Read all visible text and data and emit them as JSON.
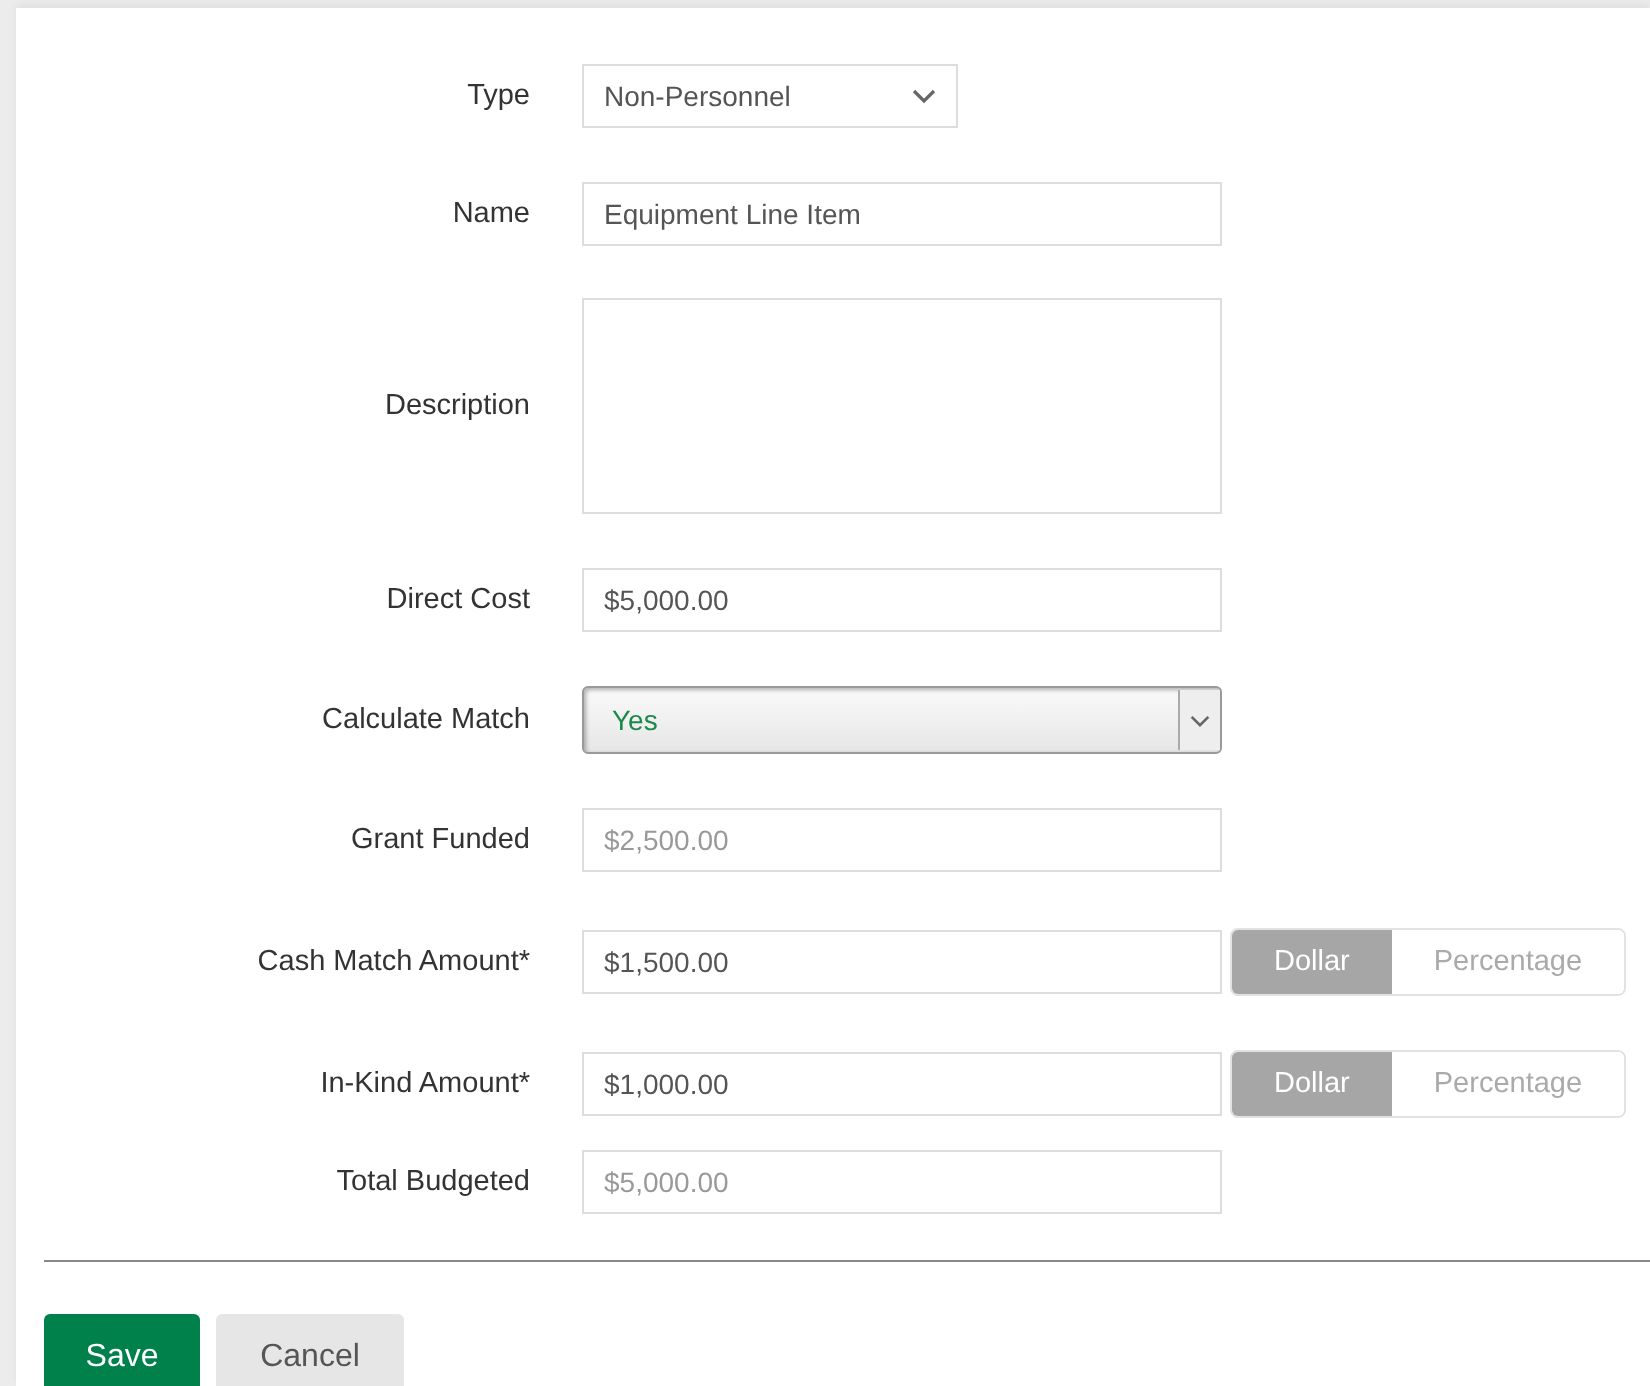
{
  "fields": [
    {
      "kind": "select",
      "label": "Type",
      "value": "Non-Personnel"
    },
    {
      "kind": "text",
      "label": "Name",
      "value": "Equipment Line Item"
    },
    {
      "kind": "textarea",
      "label": "Description"
    },
    {
      "kind": "text",
      "label": "Direct Cost",
      "value": "$5,000.00"
    },
    {
      "kind": "native-select",
      "label": "Calculate Match",
      "value": "Yes"
    },
    {
      "kind": "readonly",
      "label": "Grant Funded",
      "value": "$2,500.00"
    },
    {
      "kind": "amount",
      "label": "Cash Match Amount*",
      "value": "$1,500.00",
      "options": [
        {
          "label": "Dollar",
          "selected": true
        },
        {
          "label": "Percentage",
          "selected": false
        }
      ]
    },
    {
      "kind": "amount",
      "label": "In-Kind Amount*",
      "value": "$1,000.00",
      "options": [
        {
          "label": "Dollar",
          "selected": true
        },
        {
          "label": "Percentage",
          "selected": false
        }
      ]
    },
    {
      "kind": "readonly",
      "label": "Total Budgeted",
      "value": "$5,000.00"
    }
  ],
  "buttons": [
    {
      "kind": "primary",
      "label": "Save"
    },
    {
      "kind": "secondary",
      "label": "Cancel"
    }
  ]
}
